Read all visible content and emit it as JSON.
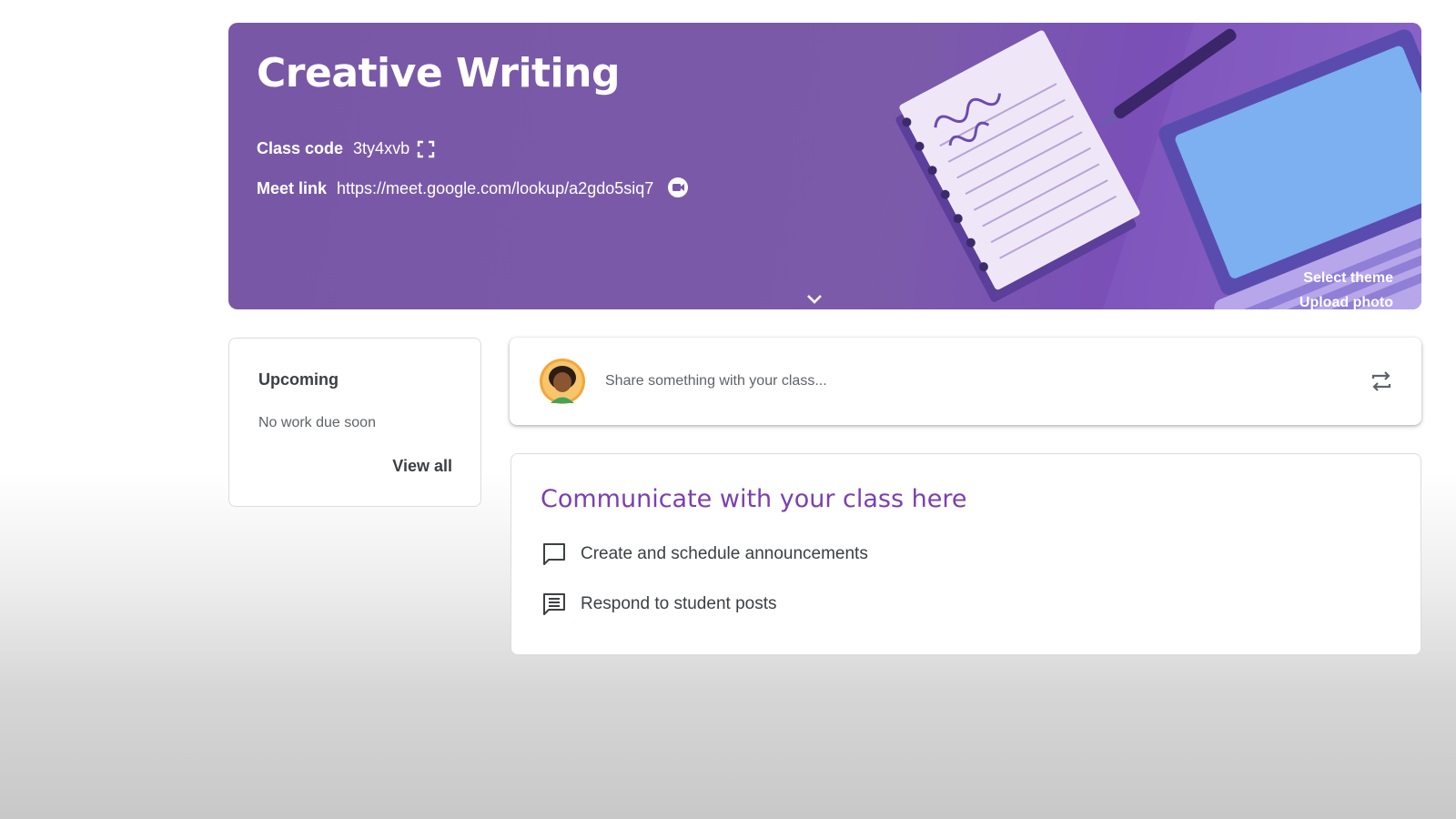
{
  "banner": {
    "title": "Creative Writing",
    "class_code_label": "Class code",
    "class_code_value": "3ty4xvb",
    "meet_link_label": "Meet link",
    "meet_link_value": "https://meet.google.com/lookup/a2gdo5siq7",
    "select_theme": "Select theme",
    "upload_photo": "Upload photo",
    "theme_color": "#7858a6"
  },
  "upcoming": {
    "title": "Upcoming",
    "empty_text": "No work due soon",
    "view_all": "View all"
  },
  "share": {
    "placeholder": "Share something with your class..."
  },
  "communicate": {
    "title": "Communicate with your class here",
    "items": [
      {
        "icon": "announcement-icon",
        "label": "Create and schedule announcements"
      },
      {
        "icon": "student-posts-icon",
        "label": "Respond to student posts"
      }
    ],
    "accent_color": "#7b3fb3"
  }
}
